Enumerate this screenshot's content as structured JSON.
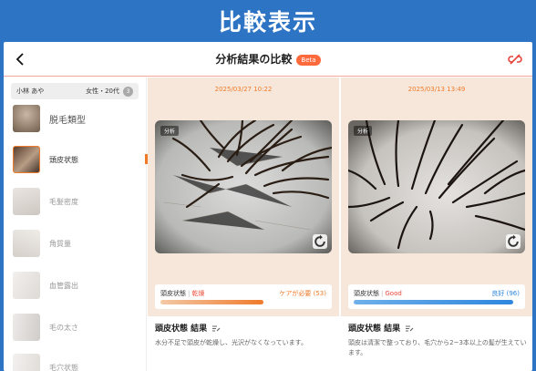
{
  "banner": {
    "title": "比較表示"
  },
  "header": {
    "title": "分析結果の比較",
    "badge": "Beta"
  },
  "user": {
    "name": "小林 あや",
    "meta": "女性・20代",
    "badge": "3"
  },
  "sidebar": {
    "items": [
      {
        "label": "脱毛類型"
      },
      {
        "label": "頭皮状態"
      },
      {
        "label": "毛髪密度"
      },
      {
        "label": "角質量"
      },
      {
        "label": "血管露出"
      },
      {
        "label": "毛の太さ"
      },
      {
        "label": "毛穴状態"
      }
    ],
    "selected_index": 1
  },
  "panels": [
    {
      "date": "2025/03/27 10:22",
      "photo_tag": "分析",
      "result_label": "頭皮状態",
      "result_value": "乾燥",
      "status_text": "ケアが必要 (53)",
      "score_fraction": 0.53,
      "section_title": "頭皮状態 結果",
      "description": "水分不足で頭皮が乾燥し、光沢がなくなっています。"
    },
    {
      "date": "2025/03/13 13:49",
      "photo_tag": "分析",
      "result_label": "頭皮状態",
      "result_value": "Good",
      "status_text": "良好 (96)",
      "score_fraction": 0.96,
      "section_title": "頭皮状態 結果",
      "description": "頭皮は清潔で整っており、毛穴から2~3本以上の髪が生えています。"
    }
  ],
  "colors": {
    "banner": "#2e74c4",
    "accent_orange": "#f07a2a",
    "bad_red": "#f0503c",
    "good_red": "#e8433a",
    "good_blue": "#2e86de",
    "panel_bg": "#f6e7da"
  }
}
